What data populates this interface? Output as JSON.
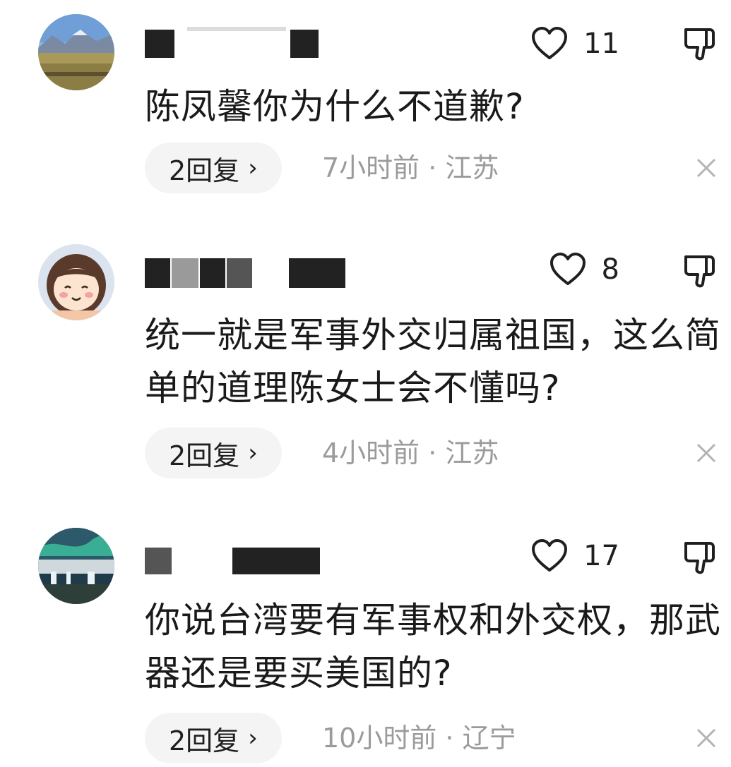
{
  "comments": [
    {
      "avatar_icon": "landscape-avatar-icon",
      "likes": "11",
      "text": "陈凤馨你为什么不道歉?",
      "replies_label": "2回复",
      "meta": "7小时前 · 江苏"
    },
    {
      "avatar_icon": "cartoon-girl-avatar-icon",
      "likes": "8",
      "text": "统一就是军事外交归属祖国，这么简单的道理陈女士会不懂吗?",
      "replies_label": "2回复",
      "meta": "4小时前 · 江苏"
    },
    {
      "avatar_icon": "aurora-waterfall-avatar-icon",
      "likes": "17",
      "text": "你说台湾要有军事权和外交权，那武器还是要买美国的?",
      "replies_label": "2回复",
      "meta": "10小时前 · 辽宁"
    }
  ],
  "icons": {
    "like": "heart-outline-icon",
    "dislike": "thumbs-down-icon",
    "close": "close-icon",
    "chevron": "chevron-right-icon"
  },
  "colors": {
    "background": "#ffffff",
    "meta_text": "#9b9b9b",
    "pill_background": "#f4f4f4"
  }
}
